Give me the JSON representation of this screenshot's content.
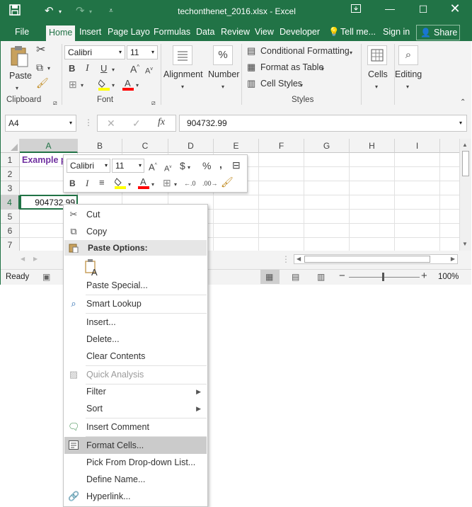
{
  "window": {
    "title": "techonthenet_2016.xlsx - Excel"
  },
  "colors": {
    "brand": "#217346",
    "heading_text": "#7030a0",
    "selection": "#217346"
  },
  "ribbon_tabs": [
    "File",
    "Home",
    "Insert",
    "Page Layo",
    "Formulas",
    "Data",
    "Review",
    "View",
    "Developer",
    "Tell me...",
    "Sign in",
    "Share"
  ],
  "ribbon": {
    "paste_label": "Paste",
    "clipboard_label": "Clipboard",
    "font_name": "Calibri",
    "font_size": "11",
    "font_label": "Font",
    "alignment_label": "Alignment",
    "number_label": "Number",
    "conditional_formatting": "Conditional Formatting",
    "format_as_table": "Format as Table",
    "cell_styles": "Cell Styles",
    "styles_label": "Styles",
    "cells_label": "Cells",
    "editing_label": "Editing",
    "number_symbol": "%"
  },
  "formula_bar": {
    "name_box": "A4",
    "fx": "fx",
    "value": "904732.99"
  },
  "grid": {
    "columns": [
      "A",
      "B",
      "C",
      "D",
      "E",
      "F",
      "G",
      "H",
      "I"
    ],
    "rows": [
      "1",
      "2",
      "3",
      "4",
      "5",
      "6",
      "7"
    ],
    "a1_text": "Example p",
    "a4_value": "904732.99"
  },
  "mini_toolbar": {
    "font_name": "Calibri",
    "font_size": "11"
  },
  "context_menu": {
    "cut": "Cut",
    "copy": "Copy",
    "paste_options_header": "Paste Options:",
    "paste_special": "Paste Special...",
    "smart_lookup": "Smart Lookup",
    "insert": "Insert...",
    "delete": "Delete...",
    "clear_contents": "Clear Contents",
    "quick_analysis": "Quick Analysis",
    "filter": "Filter",
    "sort": "Sort",
    "insert_comment": "Insert Comment",
    "format_cells": "Format Cells...",
    "pick_from_list": "Pick From Drop-down List...",
    "define_name": "Define Name...",
    "hyperlink": "Hyperlink..."
  },
  "status_bar": {
    "status": "Ready",
    "zoom": "100%"
  }
}
